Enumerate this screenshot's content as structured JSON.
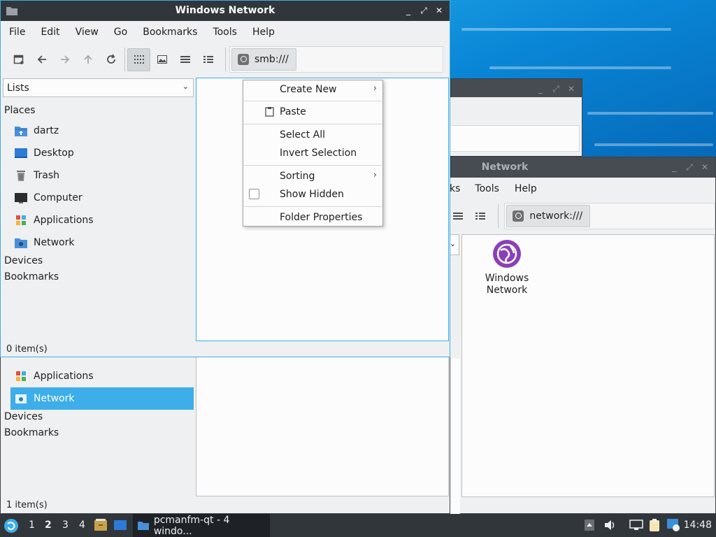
{
  "front_window": {
    "title": "Windows Network",
    "menu": [
      "File",
      "Edit",
      "View",
      "Go",
      "Bookmarks",
      "Tools",
      "Help"
    ],
    "path": "smb:///",
    "view_mode": "Lists",
    "sidebar": {
      "places_header": "Places",
      "items": [
        {
          "label": "dartz",
          "icon": "home-folder-icon"
        },
        {
          "label": "Desktop",
          "icon": "desktop-icon"
        },
        {
          "label": "Trash",
          "icon": "trash-icon"
        },
        {
          "label": "Computer",
          "icon": "computer-icon"
        },
        {
          "label": "Applications",
          "icon": "applications-icon"
        },
        {
          "label": "Network",
          "icon": "network-icon"
        }
      ],
      "devices_header": "Devices",
      "bookmarks_header": "Bookmarks"
    },
    "status": "0 item(s)"
  },
  "context_menu": {
    "items": [
      {
        "label": "Create New",
        "submenu": true
      },
      {
        "label": "Paste",
        "icon": "clipboard-icon"
      },
      {
        "label": "Select All"
      },
      {
        "label": "Invert Selection"
      },
      {
        "label": "Sorting",
        "submenu": true
      },
      {
        "label": "Show Hidden",
        "checkbox": false
      },
      {
        "label": "Folder Properties"
      }
    ]
  },
  "back_window": {
    "title": "Network",
    "menu_visible": [
      "ks",
      "Tools",
      "Help"
    ],
    "path": "network:///",
    "file_item": {
      "line1": "Windows",
      "line2": "Network"
    }
  },
  "lower_window": {
    "sidebar": {
      "items": [
        {
          "label": "Applications"
        },
        {
          "label": "Network",
          "selected": true
        }
      ],
      "devices_header": "Devices",
      "bookmarks_header": "Bookmarks"
    },
    "status": "1 item(s)"
  },
  "taskbar": {
    "workspaces": [
      "1",
      "2",
      "3",
      "4"
    ],
    "current_workspace": "2",
    "task_label": "pcmanfm-qt - 4 windo...",
    "clock": "14:48"
  },
  "colors": {
    "accent": "#3daee9",
    "titlebar": "#31363b",
    "globe": "#8a3fb8"
  }
}
